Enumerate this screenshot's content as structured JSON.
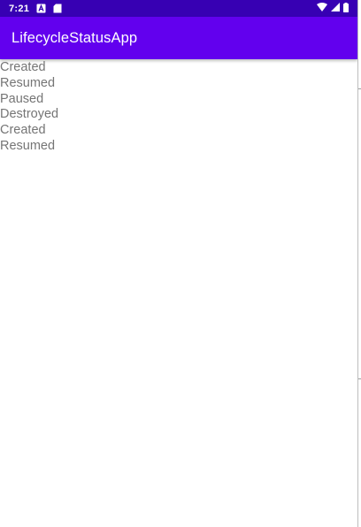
{
  "status_bar": {
    "time": "7:21",
    "background": "#3700b3"
  },
  "app_bar": {
    "title": "LifecycleStatusApp",
    "background": "#6200ee"
  },
  "log": {
    "lines": [
      "Created",
      "Resumed",
      "Paused",
      "Destroyed",
      "Created",
      "Resumed"
    ],
    "text_color": "#757575"
  }
}
